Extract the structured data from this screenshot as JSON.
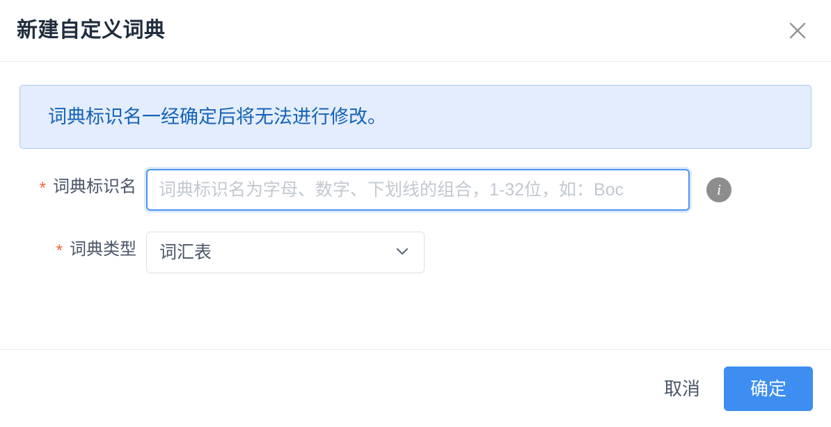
{
  "dialog": {
    "title": "新建自定义词典",
    "close_icon": "close-icon"
  },
  "alert": {
    "message": "词典标识名一经确定后将无法进行修改。",
    "bg_color": "#e4edfd",
    "border_color": "#a7ccf5",
    "text_color": "#1462b8"
  },
  "form": {
    "required_marker": "*",
    "required_color": "#f5613d",
    "fields": [
      {
        "label": "词典标识名",
        "type": "text",
        "value": "",
        "placeholder": "词典标识名为字母、数字、下划线的组合，1-32位，如：Boc",
        "help_icon": "info-icon"
      },
      {
        "label": "词典类型",
        "type": "select",
        "value": "词汇表",
        "chevron_icon": "chevron-down-icon"
      }
    ]
  },
  "footer": {
    "cancel_label": "取消",
    "confirm_label": "确定",
    "confirm_color": "#3d8ef0"
  }
}
